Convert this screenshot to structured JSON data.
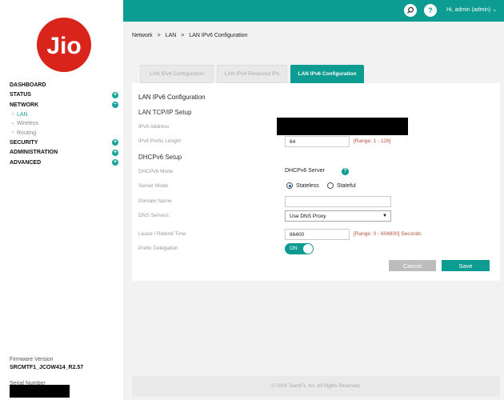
{
  "brand": {
    "logo_text": "Jio",
    "logo_color": "#d9241c",
    "accent": "#0d9c91"
  },
  "sidebar": {
    "items": [
      {
        "label": "DASHBOARD",
        "toggle": ""
      },
      {
        "label": "STATUS",
        "toggle": "+"
      },
      {
        "label": "NETWORK",
        "toggle": "−"
      },
      {
        "label": "SECURITY",
        "toggle": "+"
      },
      {
        "label": "ADMINISTRATION",
        "toggle": "+"
      },
      {
        "label": "ADVANCED",
        "toggle": "+"
      }
    ],
    "network_sub": [
      "LAN",
      "Wireless",
      "Routing"
    ],
    "firmware_label": "Firmware Version",
    "firmware_value": "SRCMTF1_JCOW414_R2.57",
    "serial_label": "Serial Number"
  },
  "header": {
    "user": "Hi, admin (admin)",
    "search_icon": "search-icon",
    "help_icon": "?"
  },
  "breadcrumb": [
    "Network",
    ">",
    "LAN",
    ">",
    "LAN IPv6 Configuration"
  ],
  "tabs": [
    {
      "label": "LAN IPv4 Configuration"
    },
    {
      "label": "LAN IPv4 Reserved IPs"
    },
    {
      "label": "LAN IPv6 Configuration"
    }
  ],
  "form": {
    "title": "LAN IPv6 Configuration",
    "lan_section": "LAN TCP/IP Setup",
    "ipv6_address_label": "IPv6 Address",
    "prefix_length_label": "IPv6 Prefix Length",
    "prefix_length_value": "64",
    "prefix_range": "[Range: 1 - 128]",
    "dhcp_section": "DHCPv6 Setup",
    "dhcp_mode_label": "DHCPv6 Mode",
    "dhcp_mode_value": "DHCPv6 Server",
    "server_mode_label": "Server Mode",
    "server_mode_options": [
      "Stateless",
      "Stateful"
    ],
    "domain_name_label": "Domain Name",
    "domain_name_value": "",
    "dns_label": "DNS Servers",
    "dns_value": "Use DNS Proxy",
    "lease_label": "Lease / Rebind Time",
    "lease_value": "86400",
    "lease_range": "[Range: 0 - 604800] Seconds",
    "prefix_delegation_label": "Prefix Delegation",
    "prefix_delegation_state": "ON",
    "cancel_label": "Cancel",
    "save_label": "Save"
  },
  "footer": {
    "copyright": "© 2019 TeamF1, Inc. All Rights Reserved."
  }
}
